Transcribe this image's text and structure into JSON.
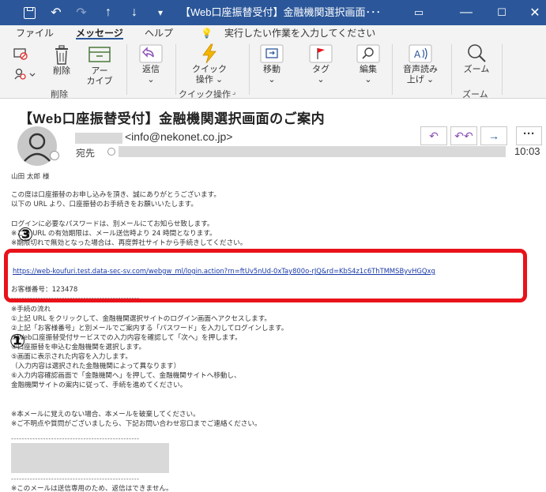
{
  "window": {
    "title": "【Web口座振替受付】金融機関選択画面･･･"
  },
  "menu": {
    "file": "ファイル",
    "message": "メッセージ",
    "help": "ヘルプ",
    "tell_me": "実行したい作業を入力してください"
  },
  "ribbon": {
    "delete": "削除",
    "archive_line1": "アー",
    "archive_line2": "カイブ",
    "reply": "返信",
    "quick_line1": "クイック",
    "quick_line2": "操作",
    "move": "移動",
    "tag": "タグ",
    "edit": "編集",
    "speech_line1": "音声読み",
    "speech_line2": "上げ",
    "zoom": "ズーム",
    "group_delete": "削除",
    "group_quick": "クイック操作",
    "group_zoom": "ズーム"
  },
  "mail": {
    "subject": "【Web口座振替受付】金融機関選択画面のご案内",
    "sender_email": "<info@nekonet.co.jp>",
    "to_label": "宛先",
    "time": "10:03"
  },
  "body": {
    "greeting": "山田 太郎 様",
    "l1": "この度は口座振替のお申し込みを頂き、誠にありがとうございます。",
    "l2": "以下の URL より、口座振替のお手続きをお願いいたします。",
    "l3": "ログインに必要なパスワードは、別メールにてお知らせ致します。",
    "l4": "※この URL の有効期限は、メール送信時より 24 時間となります。",
    "l5": "※期限切れで無効となった場合は、再度弊社サイトから手続きしてください。",
    "url": "https://web-koufuri.test.data-sec-sv.com/webgw_ml/login.action?rn=ftUv5nUd-0xTay800o-rJQ&rd=KbS4z1c6ThTMMSByvHGQxg",
    "customer_no": "お客様番号：123478",
    "dashes": "------------------------------------------------",
    "steps_title": "※手続の流れ",
    "s1": "①上記 URL をクリックして、金融機関選択サイトのログイン画面へアクセスします。",
    "s2": "②上記「お客様番号」と別メールでご案内する「パスワード」を入力してログインします。",
    "s3": "③Web口座振替受付サービスでの入力内容を確認して「次へ」を押します。",
    "s4": "④口座振替を申込む金融機関を選択します。",
    "s5": "⑤画面に表示された内容を入力します。",
    "s6": "（入力内容は選択された金融機関によって異なります）",
    "s7": "⑥入力内容確認画面で「金融機関へ」を押して、金融機関サイトへ移動し、",
    "s8": "金融機関サイトの案内に従って、手続を進めてください。",
    "n1": "※本メールに覚えのない場合、本メールを破棄してください。",
    "n2": "※ご不明点や質問がございましたら、下記お問い合わせ窓口までご連絡ください。",
    "footer": "※このメールは送信専用のため、返信はできません。",
    "badge3": "③",
    "badge1": "①"
  }
}
